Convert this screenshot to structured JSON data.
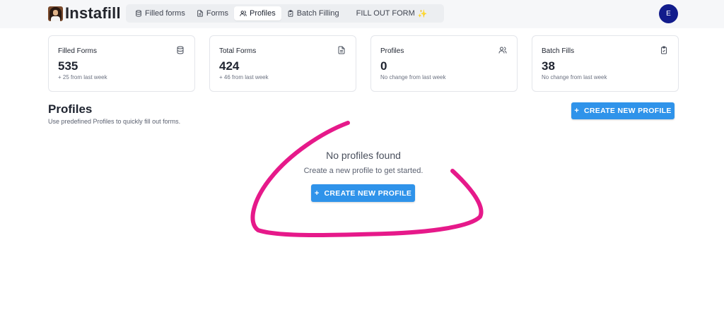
{
  "app": {
    "name": "Instafill"
  },
  "nav": {
    "items": [
      {
        "label": "Filled forms",
        "icon": "database-icon"
      },
      {
        "label": "Forms",
        "icon": "document-icon"
      },
      {
        "label": "Profiles",
        "icon": "users-icon",
        "active": true
      },
      {
        "label": "Batch Filling",
        "icon": "clipboard-check-icon"
      }
    ],
    "fill_out": "FILL OUT FORM",
    "fill_out_icon": "sparkles-icon"
  },
  "user": {
    "avatar_initial": "E",
    "avatar_color": "#121c8c"
  },
  "stats": [
    {
      "title": "Filled Forms",
      "value": "535",
      "sub": "+ 25 from last week",
      "icon": "database-icon"
    },
    {
      "title": "Total Forms",
      "value": "424",
      "sub": "+ 46 from last week",
      "icon": "document-icon"
    },
    {
      "title": "Profiles",
      "value": "0",
      "sub": "No change from last week",
      "icon": "users-icon"
    },
    {
      "title": "Batch Fills",
      "value": "38",
      "sub": "No change from last week",
      "icon": "clipboard-check-icon"
    }
  ],
  "profiles": {
    "title": "Profiles",
    "subtitle": "Use predefined Profiles to quickly fill out forms.",
    "create_button": "CREATE NEW PROFILE",
    "empty": {
      "title": "No profiles found",
      "subtitle": "Create a new profile to get started.",
      "button": "CREATE NEW PROFILE"
    }
  },
  "colors": {
    "accent": "#2f93ea",
    "annotation": "#e6198a"
  }
}
